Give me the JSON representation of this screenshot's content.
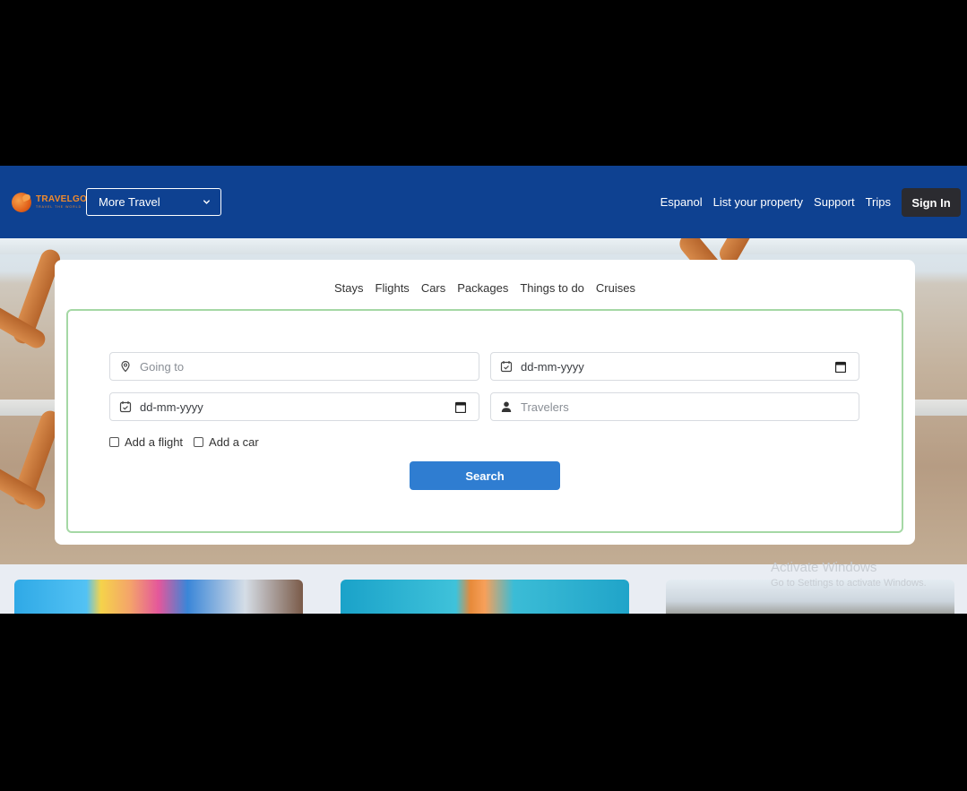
{
  "header": {
    "logo": {
      "name": "TRAVELGO",
      "tagline": "TRAVEL THE WORLD"
    },
    "more_travel_label": "More Travel",
    "nav": [
      "Espanol",
      "List your property",
      "Support",
      "Trips"
    ],
    "signin_label": "Sign In",
    "colors": {
      "navbar": "#0e4191",
      "signin": "#2b2b30",
      "logo": "#f08a2c"
    }
  },
  "search": {
    "tabs": [
      "Stays",
      "Flights",
      "Cars",
      "Packages",
      "Things to do",
      "Cruises"
    ],
    "going_to_placeholder": "Going to",
    "date1_value": "dd-mm-yyyy",
    "date2_value": "dd-mm-yyyy",
    "travelers_placeholder": "Travelers",
    "add_flight_label": "Add a flight",
    "add_car_label": "Add a car",
    "search_label": "Search",
    "colors": {
      "button": "#2f7dd1",
      "box_border": "#a5d8a5"
    },
    "icons": [
      "location-pin-icon",
      "calendar-check-icon",
      "calendar-icon",
      "person-icon"
    ]
  },
  "watermark": {
    "title": "Activate Windows",
    "subtitle": "Go to Settings to activate Windows."
  }
}
